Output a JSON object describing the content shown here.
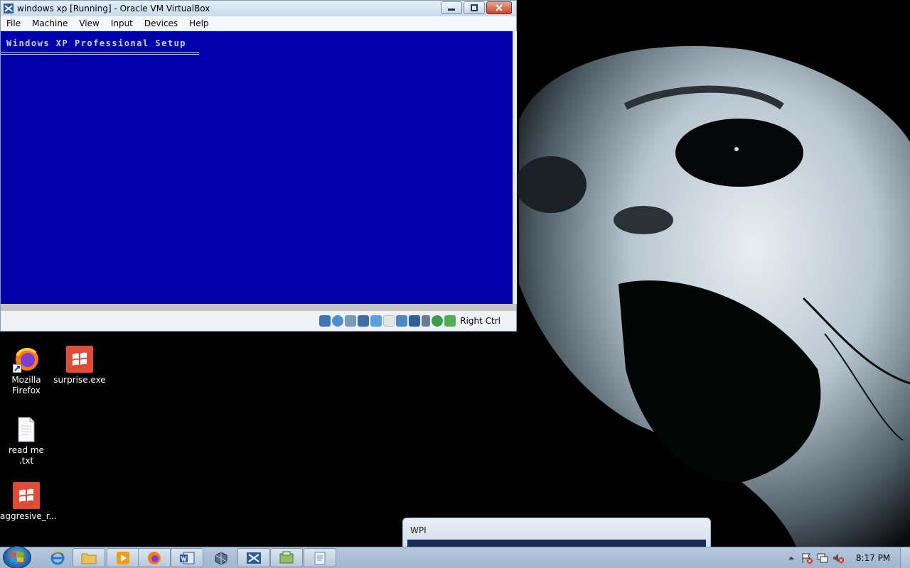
{
  "vbox": {
    "title": "windows xp [Running] - Oracle VM VirtualBox",
    "menu": [
      "File",
      "Machine",
      "View",
      "Input",
      "Devices",
      "Help"
    ],
    "vm_screen": {
      "setup_title": "Windows XP Professional Setup",
      "background_color": "#0000a8"
    },
    "status": {
      "icons": [
        "hard-disk-icon",
        "optical-drive-icon",
        "floppy-icon",
        "network-icon",
        "usb-icon",
        "shared-folders-icon",
        "display-icon",
        "video-capture-icon",
        "cpu-icon",
        "globe-icon",
        "mouse-integration-icon"
      ],
      "host_key": "Right Ctrl"
    }
  },
  "desktop": {
    "icons": [
      {
        "label": "Mozilla\nFirefox",
        "icon": "firefox-icon"
      },
      {
        "label": "surprise.exe",
        "icon": "windows-exe-icon"
      },
      {
        "label": "read me .txt",
        "icon": "text-file-icon"
      },
      {
        "label": "aggresive_r...",
        "icon": "windows-exe-icon"
      }
    ]
  },
  "wpi_preview": {
    "title": "WPI"
  },
  "taskbar": {
    "items": [
      "start-orb-icon",
      "internet-explorer-icon",
      "explorer-folder-icon",
      "media-player-icon",
      "firefox-icon",
      "word-icon",
      "virtualbox-icon",
      "setup-icon",
      "package-icon",
      "notepad-icon"
    ],
    "tray_icons": [
      "show-hidden-icons-icon",
      "flag-alert-icon",
      "network-icon",
      "volume-muted-icon"
    ],
    "clock": "8:17 PM"
  },
  "colors": {
    "xp_setup_blue": "#0000a8",
    "taskbar": "#a9bdd3",
    "exe_red": "#e04b36"
  }
}
